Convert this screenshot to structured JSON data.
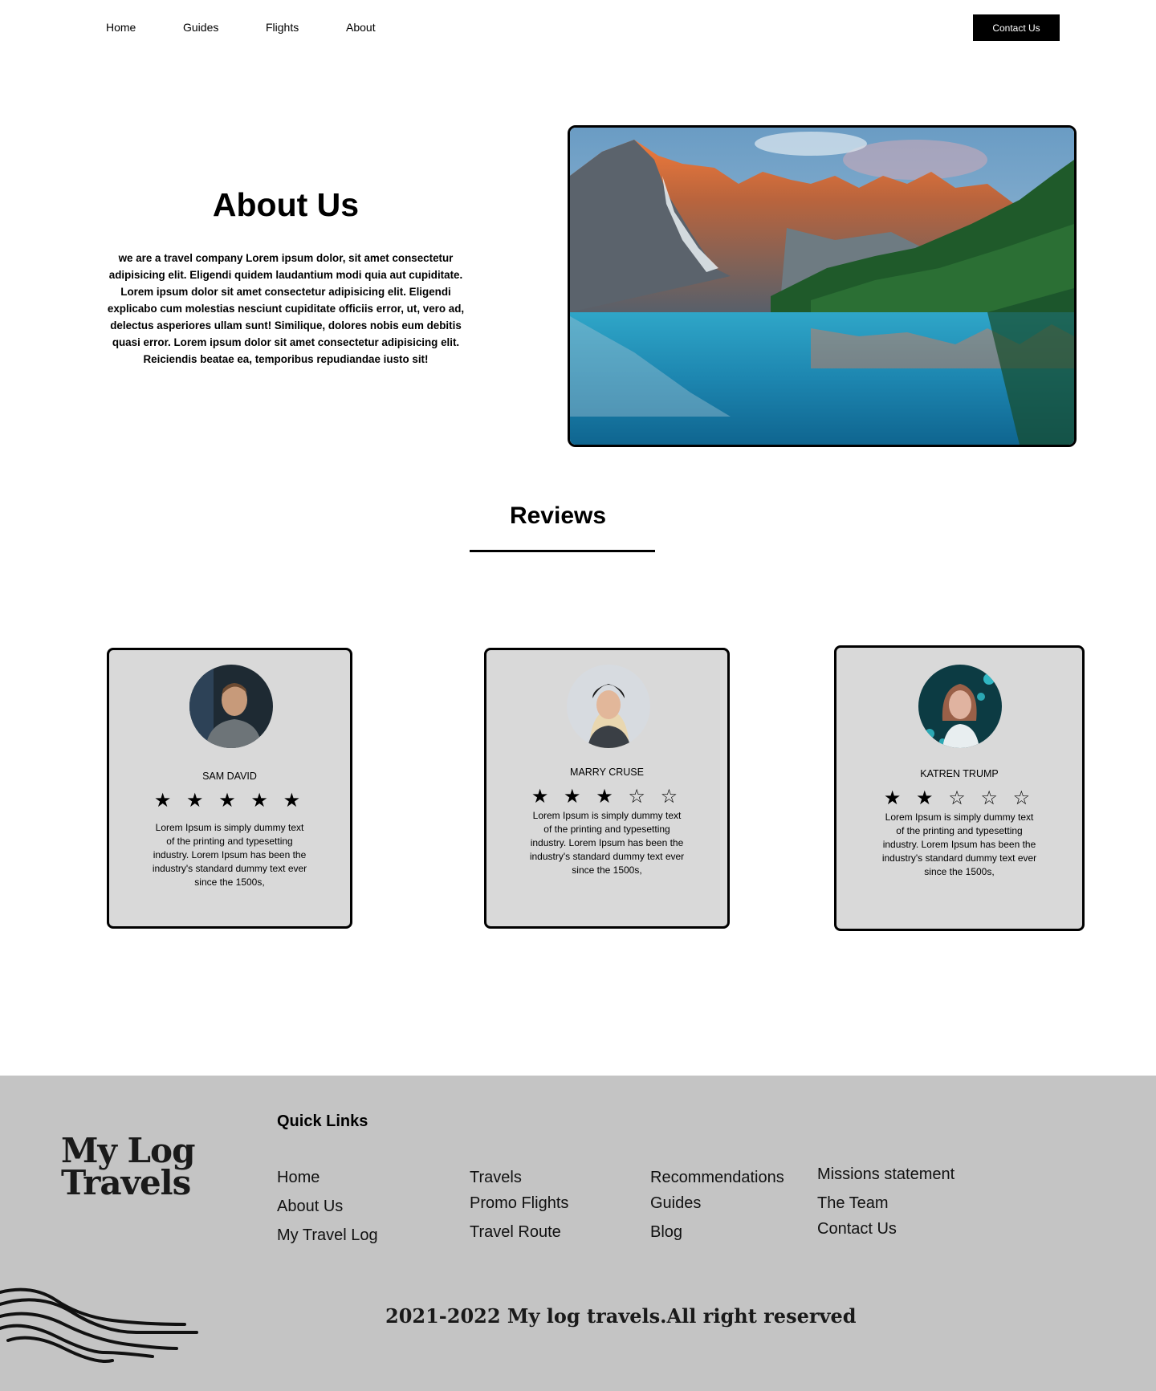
{
  "nav": {
    "links": [
      "Home",
      "Guides",
      "Flights",
      "About"
    ],
    "contact_label": "Contact Us"
  },
  "about": {
    "title": "About Us",
    "text": "we are a travel company Lorem ipsum dolor, sit amet consectetur adipisicing elit. Eligendi quidem laudantium modi quia aut cupiditate. Lorem ipsum dolor sit amet consectetur adipisicing elit. Eligendi explicabo cum molestias nesciunt cupiditate officiis error, ut, vero ad, delectus asperiores ullam sunt! Similique, dolores nobis eum debitis quasi error. Lorem ipsum dolor sit amet consectetur adipisicing elit. Reiciendis beatae ea, temporibus repudiandae iusto sit!"
  },
  "reviews": {
    "title": "Reviews",
    "cards": [
      {
        "name": "SAM DAVID",
        "stars": "★ ★ ★ ★ ★",
        "rating": 5,
        "text": "Lorem Ipsum is simply dummy text of the printing and typesetting industry. Lorem Ipsum has been the industry's standard dummy text ever since the 1500s,"
      },
      {
        "name": "MARRY CRUSE",
        "stars": "★ ★ ★ ☆ ☆",
        "rating": 3,
        "text": "Lorem Ipsum is simply dummy text of the printing and typesetting industry. Lorem Ipsum has been the industry's standard dummy text ever since the 1500s,"
      },
      {
        "name": "KATREN TRUMP",
        "stars": "★ ★ ☆ ☆ ☆",
        "rating": 2,
        "text": "Lorem Ipsum is simply dummy text of the printing and typesetting industry. Lorem Ipsum has been the industry's standard dummy text ever since the 1500s,"
      }
    ]
  },
  "footer": {
    "logo_line1": "My Log",
    "logo_line2": "Travels",
    "quick_links_title": "Quick Links",
    "col1": [
      "Home",
      "About Us",
      "My Travel Log"
    ],
    "col2": [
      "Travels",
      "Promo Flights",
      "Travel Route"
    ],
    "col3": [
      "Recommendations",
      "Guides",
      "Blog"
    ],
    "col4": [
      "Missions statement",
      "The Team",
      "Contact Us"
    ],
    "copyright": "2021-2022 My log travels.All right reserved"
  },
  "colors": {
    "footer_bg": "#c4c4c4",
    "card_bg": "#d9d9d9",
    "button_bg": "#000000"
  }
}
